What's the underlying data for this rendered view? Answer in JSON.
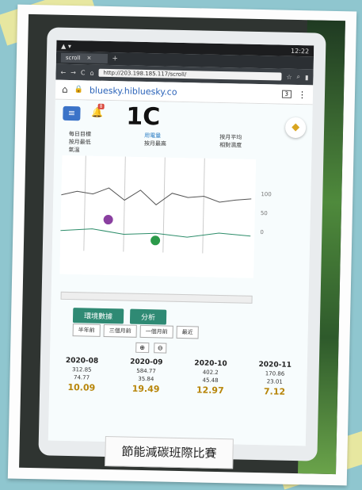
{
  "phone": {
    "time": "12:22"
  },
  "browser": {
    "tab_title": "scroll",
    "url": "http://203.198.185.117/scroll/"
  },
  "page": {
    "site": "bluesky.hibluesky.co",
    "tab_count": "3",
    "notification_count": "8",
    "room": "1C"
  },
  "legend": [
    "每日目標",
    "用電量",
    "按月平均",
    "按月最低",
    "按月最高",
    "相對濕度",
    "氣溫"
  ],
  "buttons": {
    "env": "環境數據",
    "analysis": "分析"
  },
  "ranges": [
    "半年前",
    "三個月前",
    "一個月前",
    "最近"
  ],
  "months": [
    {
      "month": "2020-08",
      "v1": "312.85",
      "v2": "74.77",
      "v3": "10.09"
    },
    {
      "month": "2020-09",
      "v1": "584.77",
      "v2": "35.84",
      "v3": "19.49"
    },
    {
      "month": "2020-10",
      "v1": "402.2",
      "v2": "45.48",
      "v3": "12.97"
    },
    {
      "month": "2020-11",
      "v1": "170.86",
      "v2": "23.01",
      "v3": "7.12"
    }
  ],
  "sign": "節能減碳班際比賽"
}
